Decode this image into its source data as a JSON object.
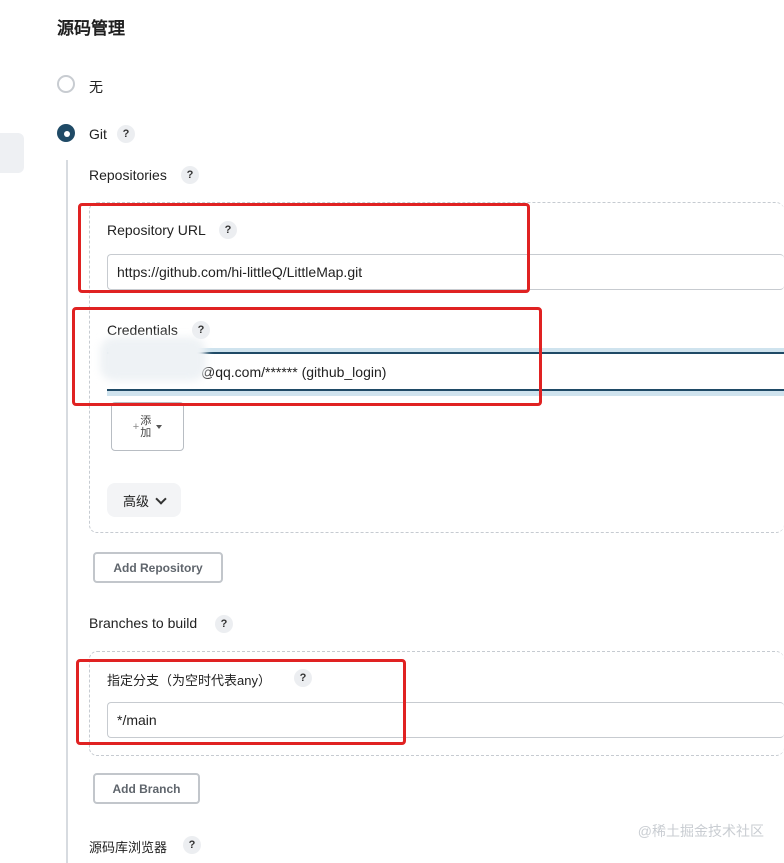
{
  "section": {
    "title": "源码管理"
  },
  "scm_options": [
    {
      "label": "无",
      "selected": false
    },
    {
      "label": "Git",
      "selected": true
    }
  ],
  "git": {
    "repositories_label": "Repositories",
    "repository_url_label": "Repository URL",
    "repository_url_value": "https://github.com/hi-littleQ/LittleMap.git",
    "credentials_label": "Credentials",
    "credentials_value": "@qq.com/****** (github_login)",
    "add_button": {
      "line1": "添",
      "line2": "加"
    },
    "advanced_label": "高级",
    "add_repository_label": "Add Repository",
    "branches_label": "Branches to build",
    "branch_specifier_label": "指定分支（为空时代表any）",
    "branch_specifier_value": "*/main",
    "add_branch_label": "Add Branch",
    "repo_browser_label": "源码库浏览器"
  },
  "help_symbol": "?",
  "watermark": "@稀土掘金技术社区",
  "colors": {
    "accent": "#1f4a66",
    "annotation": "#e02222"
  }
}
